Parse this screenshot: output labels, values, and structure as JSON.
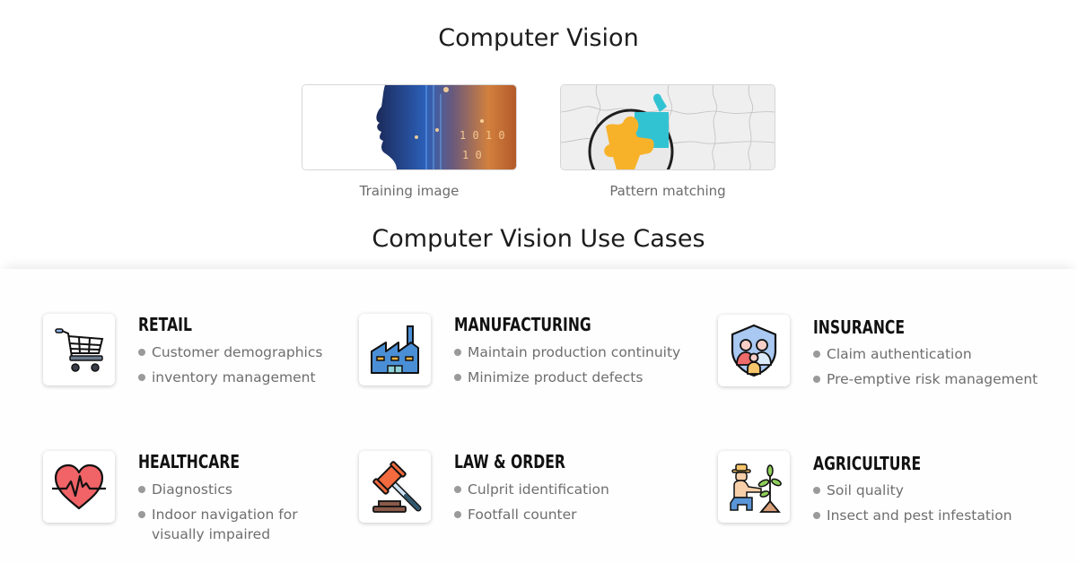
{
  "header": {
    "title": "Computer Vision",
    "images": [
      {
        "caption": "Training image",
        "icon": "ai-head-image"
      },
      {
        "caption": "Pattern matching",
        "icon": "puzzle-magnifier-image"
      }
    ],
    "subtitle": "Computer Vision Use Cases"
  },
  "use_cases": [
    {
      "title": "RETAIL",
      "icon": "shopping-cart-icon",
      "bullets": [
        "Customer demographics",
        "inventory management"
      ]
    },
    {
      "title": "MANUFACTURING",
      "icon": "factory-icon",
      "bullets": [
        "Maintain production continuity",
        "Minimize product defects"
      ]
    },
    {
      "title": "INSURANCE",
      "icon": "family-shield-icon",
      "bullets": [
        "Claim authentication",
        "Pre-emptive risk management"
      ]
    },
    {
      "title": "HEALTHCARE",
      "icon": "heart-pulse-icon",
      "bullets": [
        "Diagnostics",
        "Indoor navigation for visually impaired"
      ]
    },
    {
      "title": "LAW & ORDER",
      "icon": "gavel-icon",
      "bullets": [
        "Culprit identification",
        "Footfall counter"
      ]
    },
    {
      "title": "AGRICULTURE",
      "icon": "farmer-plant-icon",
      "bullets": [
        "Soil quality",
        "Insect and pest infestation"
      ]
    }
  ],
  "colors": {
    "title_text": "#1c1c1c",
    "bullet_text": "#6e6e6e",
    "bullet_dot": "#9a9a9a"
  }
}
